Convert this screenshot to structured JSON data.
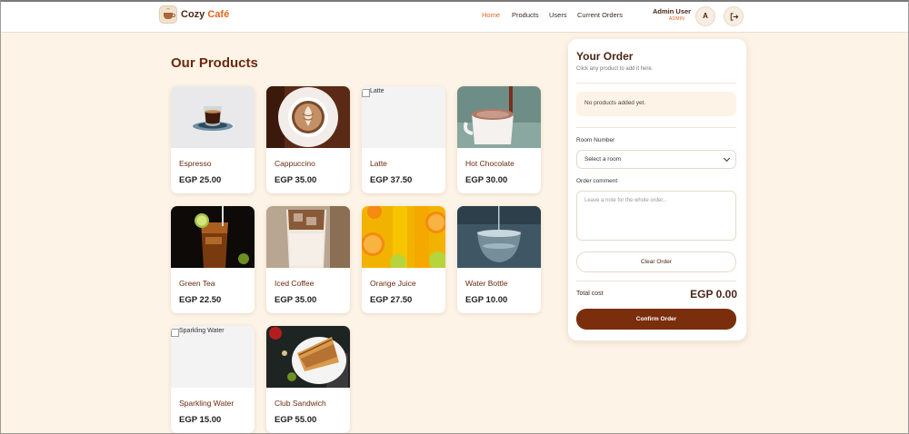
{
  "header": {
    "brand_main": "Cozy ",
    "brand_accent": "Café",
    "nav": [
      "Home",
      "Products",
      "Users",
      "Current Orders"
    ],
    "active_nav": "Home",
    "user_name": "Admin User",
    "user_role": "ADMIN",
    "avatar_initial": "A"
  },
  "products_title": "Our Products",
  "products": [
    {
      "name": "Espresso",
      "price": "EGP 25.00",
      "image": "espresso-photo"
    },
    {
      "name": "Cappuccino",
      "price": "EGP 35.00",
      "image": "cappuccino-photo"
    },
    {
      "name": "Latte",
      "price": "EGP 37.50",
      "image": "broken",
      "alt": "Latte"
    },
    {
      "name": "Hot Chocolate",
      "price": "EGP 30.00",
      "image": "hot-chocolate-photo"
    },
    {
      "name": "Green Tea",
      "price": "EGP 22.50",
      "image": "green-tea-photo"
    },
    {
      "name": "Iced Coffee",
      "price": "EGP 35.00",
      "image": "iced-coffee-photo"
    },
    {
      "name": "Orange Juice",
      "price": "EGP 27.50",
      "image": "orange-juice-photo"
    },
    {
      "name": "Water Bottle",
      "price": "EGP 10.00",
      "image": "water-bottle-photo"
    },
    {
      "name": "Sparkling Water",
      "price": "EGP 15.00",
      "image": "broken",
      "alt": "Sparkling Water"
    },
    {
      "name": "Club Sandwich",
      "price": "EGP 55.00",
      "image": "club-sandwich-photo"
    }
  ],
  "order": {
    "title": "Your Order",
    "subtitle": "Click any product to add it here.",
    "empty_text": "No products added yet.",
    "room_label": "Room Number",
    "room_placeholder": "Select a room",
    "comment_label": "Order comment",
    "comment_placeholder": "Leave a note for the whole order...",
    "clear_label": "Clear Order",
    "total_label": "Total cost",
    "total_value": "EGP 0.00",
    "confirm_label": "Confirm Order"
  },
  "colors": {
    "accent": "#e0651f",
    "primary_dark": "#7a2e0c",
    "background": "#fdf3e6"
  }
}
